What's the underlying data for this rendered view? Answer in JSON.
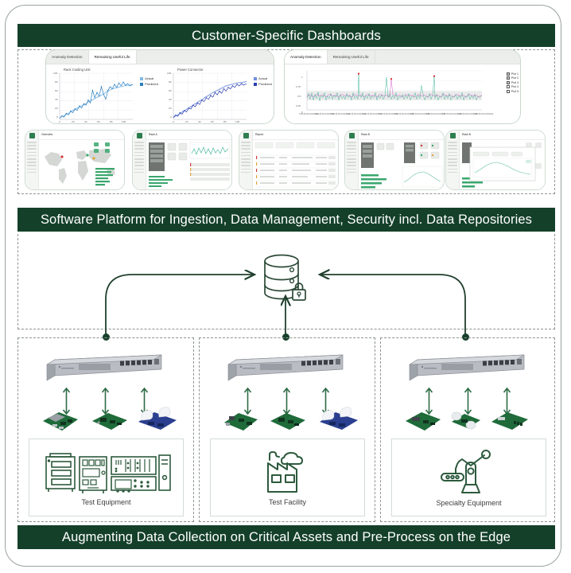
{
  "theme": {
    "banner_bg": "#14402a",
    "banner_text": "#ffffff",
    "frame_border": "#9aa39c",
    "dashed_border": "#8d948e",
    "icon_green": "#2d5a3d",
    "accent_teal": "#2fae8f",
    "accent_magenta": "#c73fc0",
    "accent_blue": "#3a5fd0",
    "accent_light_blue": "#7fb9e8",
    "anomaly_marker": "#e03030",
    "bar_green": "#3aa76d"
  },
  "banners": {
    "top": "Customer-Specific Dashboards",
    "middle": "Software Platform for Ingestion, Data Management, Security incl. Data Repositories",
    "bottom": "Augmenting Data Collection on Critical Assets and Pre-Process on the Edge"
  },
  "dashboards": {
    "left_card": {
      "tabs": [
        {
          "label": "Anomaly Detection",
          "active": false
        },
        {
          "label": "Remaining Useful Life",
          "active": true
        }
      ]
    },
    "right_card": {
      "tabs": [
        {
          "label": "Anomaly Detection",
          "active": true
        },
        {
          "label": "Remaining Useful Life",
          "active": false
        }
      ]
    },
    "thumbnails": [
      {
        "title": "Overview",
        "kind": "world-map-dashboard"
      },
      {
        "title": "Rack A",
        "kind": "rack-detail-dashboard"
      },
      {
        "title": "Report",
        "kind": "table-list-dashboard"
      },
      {
        "title": "Rack B",
        "kind": "rack-monitoring-dashboard"
      },
      {
        "title": "Rack B",
        "kind": "modal-chart-dashboard"
      }
    ]
  },
  "chart_data": [
    {
      "type": "line",
      "title": "Rack Cooling Unit",
      "xlabel": "",
      "ylabel": "",
      "xlim": [
        0,
        100
      ],
      "ylim": [
        0,
        100
      ],
      "xticks": [
        0,
        20,
        40,
        60,
        80,
        100
      ],
      "yticks": [
        0,
        20,
        40,
        60,
        80,
        100
      ],
      "grid": true,
      "legend_position": "right",
      "series": [
        {
          "name": "Actual",
          "color": "#7fb9e8",
          "x": [
            0,
            4,
            8,
            12,
            16,
            20,
            24,
            28,
            32,
            36,
            40,
            44,
            48,
            52,
            56,
            60,
            64,
            68,
            72,
            76,
            80,
            84,
            88,
            92,
            96,
            100
          ],
          "values": [
            3,
            6,
            10,
            13,
            17,
            20,
            24,
            27,
            31,
            34,
            38,
            41,
            45,
            48,
            52,
            55,
            59,
            62,
            66,
            69,
            72,
            74,
            76,
            77,
            78,
            79
          ]
        },
        {
          "name": "Predicted",
          "color": "#2a7fbf",
          "x": [
            0,
            3,
            6,
            9,
            12,
            15,
            18,
            21,
            24,
            27,
            30,
            33,
            36,
            39,
            42,
            45,
            48,
            51,
            54,
            57,
            60,
            63,
            66,
            69,
            72,
            75,
            78,
            81,
            84,
            87,
            90,
            93,
            96,
            100
          ],
          "values": [
            2,
            8,
            5,
            12,
            9,
            18,
            14,
            22,
            19,
            29,
            24,
            34,
            30,
            41,
            36,
            63,
            47,
            58,
            50,
            71,
            55,
            44,
            63,
            72,
            66,
            76,
            70,
            79,
            73,
            81,
            75,
            78,
            74,
            77
          ]
        }
      ]
    },
    {
      "type": "line",
      "title": "Power Connector",
      "xlabel": "",
      "ylabel": "",
      "xlim": [
        0,
        100
      ],
      "ylim": [
        0,
        100
      ],
      "xticks": [
        0,
        20,
        40,
        60,
        80,
        100
      ],
      "yticks": [
        0,
        20,
        40,
        60,
        80,
        100
      ],
      "grid": true,
      "legend_position": "right",
      "series": [
        {
          "name": "Actual",
          "color": "#6f8ee0",
          "x": [
            0,
            4,
            8,
            12,
            16,
            20,
            24,
            28,
            32,
            36,
            40,
            44,
            48,
            52,
            56,
            60,
            64,
            68,
            72,
            76,
            80,
            84,
            88,
            92,
            96,
            100
          ],
          "values": [
            4,
            8,
            12,
            16,
            20,
            24,
            28,
            32,
            36,
            40,
            44,
            48,
            52,
            56,
            60,
            63,
            66,
            69,
            72,
            74,
            76,
            78,
            79,
            80,
            81,
            82
          ]
        },
        {
          "name": "Predicted",
          "color": "#2b3fb0",
          "x": [
            0,
            3,
            6,
            9,
            12,
            15,
            18,
            21,
            24,
            27,
            30,
            33,
            36,
            39,
            42,
            45,
            48,
            51,
            54,
            57,
            60,
            63,
            66,
            69,
            72,
            75,
            78,
            81,
            84,
            87,
            90,
            93,
            96,
            100
          ],
          "values": [
            3,
            9,
            6,
            14,
            11,
            20,
            16,
            25,
            22,
            31,
            27,
            36,
            32,
            42,
            38,
            47,
            43,
            52,
            48,
            58,
            53,
            62,
            58,
            67,
            63,
            71,
            67,
            74,
            70,
            76,
            72,
            77,
            73,
            76
          ]
        }
      ]
    },
    {
      "type": "line",
      "title": "Anomaly Detection",
      "xlabel": "",
      "ylabel": "",
      "ylim": [
        0,
        1
      ],
      "yticks": [
        0,
        0.25,
        0.5,
        0.75,
        1
      ],
      "ytick_labels": [
        "0",
        "0.25",
        "0.5",
        "0.75",
        "1"
      ],
      "grid": true,
      "legend_position": "right",
      "legend_entries": [
        "Plot 1",
        "Plot 2",
        "Plot 3",
        "Plot 4",
        "Plot 5"
      ],
      "legend_checked": [
        true,
        true,
        true,
        false,
        false
      ],
      "xtick_labels": [
        "7:48:25 AM 10/2/2022",
        "7:49:25 AM 10/2/2022",
        "7:50:25 AM 10/2/2022",
        "7:51:25 AM 10/2/2022",
        "7:52:25 AM 10/2/2022",
        "7:53:25 AM 10/2/2022",
        "7:54:25 AM 10/2/2022",
        "7:55:25 AM 10/2/2022",
        "7:56:25 AM 10/2/2022",
        "7:57:25 AM 10/2/2022",
        "7:58:25 AM 10/2/2022",
        "7:59:25 AM 10/2/2022"
      ],
      "anomaly_peaks": [
        {
          "x_fraction": 0.3,
          "value": 0.96
        },
        {
          "x_fraction": 0.46,
          "value": 0.88
        },
        {
          "x_fraction": 0.72,
          "value": 0.9
        }
      ],
      "baseline_band": [
        0.22,
        0.48
      ]
    }
  ],
  "edge": {
    "columns": [
      {
        "device": "network-switch-appliance",
        "sensors": [
          "sensor-board-1",
          "sensor-board-2",
          "sensor-board-3"
        ],
        "equipment_label": "Test Equipment",
        "equipment_icon": "test-equipment-icon"
      },
      {
        "device": "network-switch-appliance",
        "sensors": [
          "sensor-board-1",
          "sensor-board-2",
          "sensor-board-3"
        ],
        "equipment_label": "Test Facility",
        "equipment_icon": "factory-icon"
      },
      {
        "device": "network-switch-appliance",
        "sensors": [
          "sensor-board-1",
          "sensor-board-2",
          "sensor-board-3"
        ],
        "equipment_label": "Specialty Equipment",
        "equipment_icon": "robot-arm-icon"
      }
    ]
  },
  "platform": {
    "repository_icon": "database-cylinder-icon",
    "security_icon": "padlock-icon",
    "flows": [
      "edge-left-to-repository",
      "edge-middle-to-repository",
      "edge-right-to-repository"
    ]
  }
}
